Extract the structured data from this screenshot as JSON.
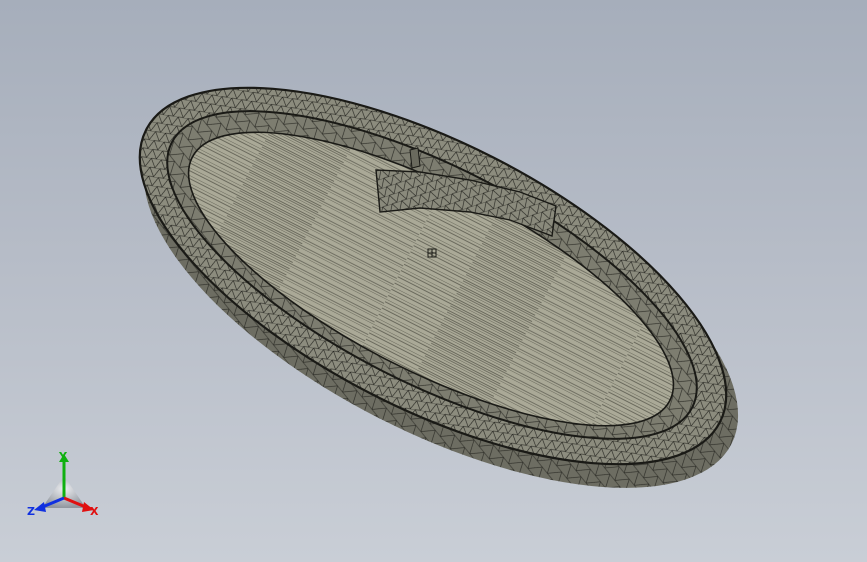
{
  "viewport": {
    "background_top": "#a6aebb",
    "background_bottom": "#c9ced6"
  },
  "model": {
    "icon": "oval-tray-mesh-model",
    "mesh_color": "#8c8c7e",
    "floor_color": "#aaa997",
    "edge_color": "#1a1a16"
  },
  "triad": {
    "icon": "coordinate-triad-icon",
    "x_label": "X",
    "y_label": "Y",
    "z_label": "Z",
    "x_color": "#e01010",
    "y_color": "#10b010",
    "z_color": "#1030e0"
  }
}
